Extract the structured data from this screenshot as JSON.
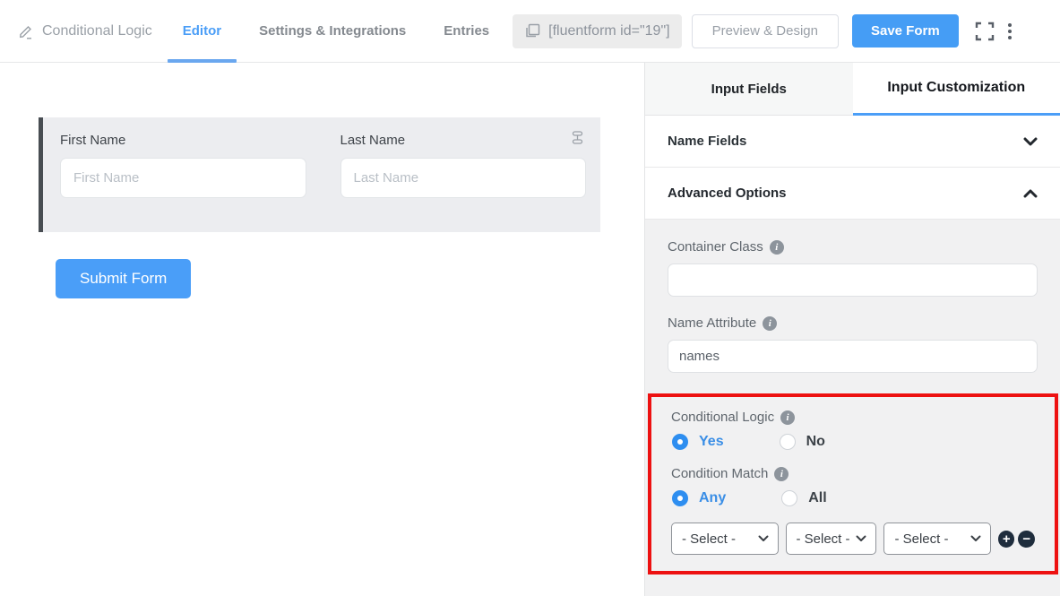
{
  "header": {
    "form_title": "Conditional Logic",
    "tabs": [
      {
        "label": "Editor",
        "active": true
      },
      {
        "label": "Settings & Integrations",
        "active": false
      },
      {
        "label": "Entries",
        "active": false
      }
    ],
    "shortcode": "[fluentform id=\"19\"]",
    "preview_button": "Preview & Design",
    "save_button": "Save Form"
  },
  "canvas": {
    "fields": [
      {
        "label": "First Name",
        "placeholder": "First Name",
        "value": ""
      },
      {
        "label": "Last Name",
        "placeholder": "Last Name",
        "value": ""
      }
    ],
    "submit_label": "Submit Form"
  },
  "panel": {
    "tabs": [
      {
        "label": "Input Fields",
        "active": false
      },
      {
        "label": "Input Customization",
        "active": true
      }
    ],
    "sections": [
      {
        "label": "Name Fields",
        "state": "collapsed"
      },
      {
        "label": "Advanced Options",
        "state": "expanded"
      }
    ],
    "container_class": {
      "label": "Container Class",
      "value": ""
    },
    "name_attribute": {
      "label": "Name Attribute",
      "value": "names"
    },
    "conditional_logic": {
      "label": "Conditional Logic",
      "yes_label": "Yes",
      "no_label": "No",
      "selected": "Yes"
    },
    "condition_match": {
      "label": "Condition Match",
      "any_label": "Any",
      "all_label": "All",
      "selected": "Any"
    },
    "condition_selects": [
      "- Select -",
      "- Select -",
      "- Select -"
    ]
  },
  "icons": {
    "kebab_glyph": "⋮",
    "plus_glyph": "+",
    "minus_glyph": "−"
  },
  "colors": {
    "accent": "#459df5",
    "accent-text": "#4b9ef7",
    "radio": "#2e8ef0",
    "radio-label": "#3a8ee6",
    "highlight": "#ed1111",
    "circle": "#1f2d3d"
  }
}
